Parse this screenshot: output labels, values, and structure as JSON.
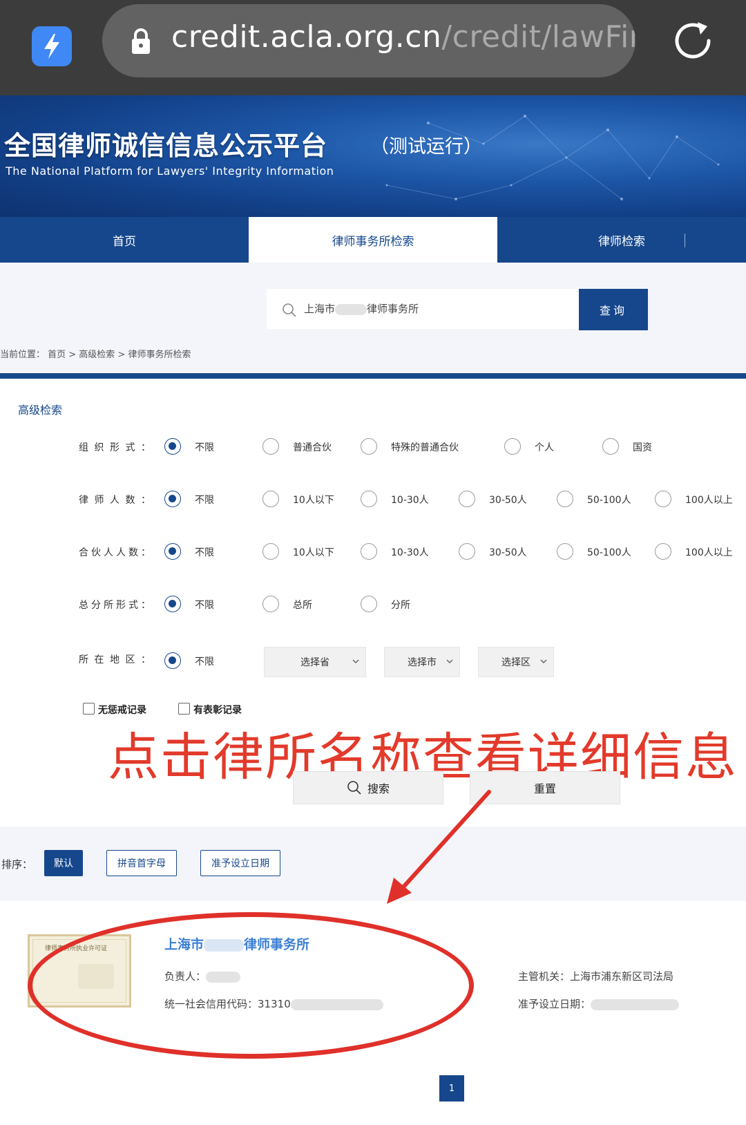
{
  "browser": {
    "url_host": "credit.acla.org.cn",
    "url_path": "/credit/lawFirm"
  },
  "banner": {
    "title": "全国律师诚信信息公示平台",
    "subtitle": "（测试运行）",
    "english": "The National Platform for  Lawyers' Integrity Information"
  },
  "nav": {
    "tabs": [
      {
        "label": "首页"
      },
      {
        "label": "律师事务所检索"
      },
      {
        "label": "律师检索"
      }
    ]
  },
  "search": {
    "value_prefix": "上海市",
    "value_suffix": "律师事务所",
    "button": "查询"
  },
  "breadcrumb": "当前位置： 首页 > 高级检索 > 律师事务所检索",
  "advanced": {
    "title": "高级检索",
    "rows": [
      {
        "label": "组织形式：",
        "options": [
          "不限",
          "普通合伙",
          "特殊的普通合伙",
          "个人",
          "国资"
        ]
      },
      {
        "label": "律师人数：",
        "options": [
          "不限",
          "10人以下",
          "10-30人",
          "30-50人",
          "50-100人",
          "100人以上"
        ]
      },
      {
        "label": "合伙人人数：",
        "options": [
          "不限",
          "10人以下",
          "10-30人",
          "30-50人",
          "50-100人",
          "100人以上"
        ]
      },
      {
        "label": "总分所形式：",
        "options": [
          "不限",
          "总所",
          "分所"
        ]
      },
      {
        "label": "所在地区：",
        "options": [
          "不限"
        ],
        "selects": [
          "选择省",
          "选择市",
          "选择区"
        ]
      }
    ],
    "checkboxes": [
      "无惩戒记录",
      "有表彰记录"
    ],
    "search_button": "搜索",
    "reset_button": "重置"
  },
  "annotation": "点击律所名称查看详细信息",
  "sort": {
    "label": "排序：",
    "options": [
      "默认",
      "拼音首字母",
      "准予设立日期"
    ]
  },
  "result": {
    "cert_text": "律师事务所执业许可证",
    "name_prefix": "上海市",
    "name_suffix": "律师事务所",
    "person_label": "负责人：",
    "credit_code_label": "统一社会信用代码：",
    "credit_code_value": "31310",
    "authority": "主管机关：上海市浦东新区司法局",
    "approve_date_label": "准予设立日期："
  },
  "pagination": {
    "current": "1"
  },
  "colors": {
    "primary": "#16478c",
    "annotation_red": "#e23a2b",
    "link_blue": "#3b7fd4"
  }
}
